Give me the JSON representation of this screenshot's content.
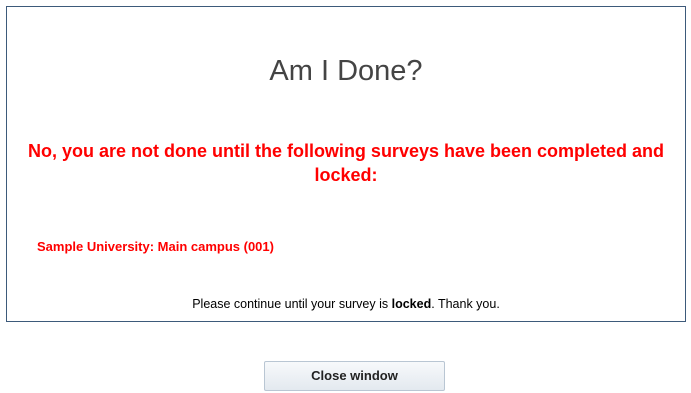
{
  "dialog": {
    "title": "Am I Done?",
    "warning": "No, you are not done until the following surveys have been completed and locked:",
    "surveys": [
      "Sample University: Main campus (001)"
    ],
    "note": {
      "before": "Please continue until your survey is ",
      "emphasis": "locked",
      "after": ". Thank you."
    }
  },
  "buttons": {
    "close_label": "Close window"
  },
  "colors": {
    "warning": "#ff0000",
    "border": "#3d5a7a",
    "title": "#444444"
  }
}
